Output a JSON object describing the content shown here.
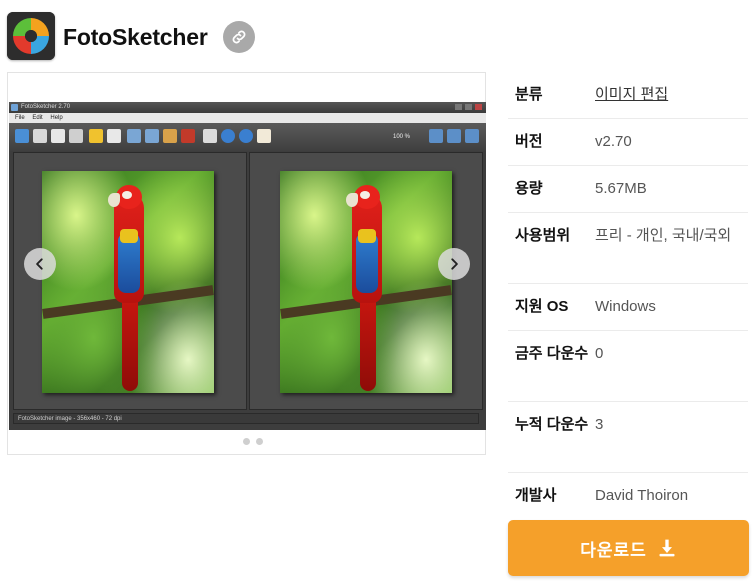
{
  "app": {
    "title": "FotoSketcher",
    "icon": "fotosketcher-logo"
  },
  "screenshot": {
    "window_title": "FotoSketcher 2.70",
    "menu": [
      "File",
      "Edit",
      "Help"
    ],
    "zoom_text": "100 %",
    "status_text": "FotoSketcher image - 356x460 - 72 dpi",
    "slide_count": 2
  },
  "info": {
    "rows": [
      {
        "label": "분류",
        "value": "이미지 편집",
        "link": true
      },
      {
        "label": "버전",
        "value": "v2.70"
      },
      {
        "label": "용량",
        "value": "5.67MB"
      },
      {
        "label": "사용범위",
        "value": "프리 - 개인, 국내/국외"
      },
      {
        "label": "지원 OS",
        "value": "Windows"
      },
      {
        "label": "금주 다운수",
        "value": "0"
      },
      {
        "label": "누적 다운수",
        "value": "3"
      },
      {
        "label": "개발사",
        "value": "David Thoiron"
      }
    ]
  },
  "download": {
    "label": "다운로드",
    "icon": "download-icon"
  },
  "colors": {
    "accent": "#f5a02a",
    "link_button": "#a9a9a9"
  }
}
